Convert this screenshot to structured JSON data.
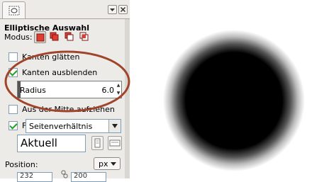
{
  "panel": {
    "title": "Elliptische Auswahl",
    "mode_label": "Modus:",
    "options": {
      "smooth_label": "Kanten glätten",
      "smooth_checked": false,
      "feather_label": "Kanten ausblenden",
      "feather_checked": true,
      "radius_label": "Radius",
      "radius_value": "6.0",
      "center_label": "Aus der Mitte aufziehen",
      "center_checked": false,
      "fixed_label": "Fest:",
      "fixed_checked": true,
      "fixed_option": "Seitenverhältnis",
      "current_value": "Aktuell"
    },
    "position_label": "Position:",
    "unit": "px",
    "pos_x": "232",
    "pos_y": "200"
  },
  "icons": [
    "tool-tab-icon",
    "dock-menu-icon",
    "close-icon",
    "mode-replace-icon",
    "mode-add-icon",
    "mode-subtract-icon",
    "mode-intersect-icon",
    "portrait-icon",
    "landscape-icon",
    "chain-icon"
  ],
  "colors": {
    "annotation_ellipse": "#a0442a",
    "mode_active": "#e03c31",
    "checkbox_check": "#21a121"
  }
}
